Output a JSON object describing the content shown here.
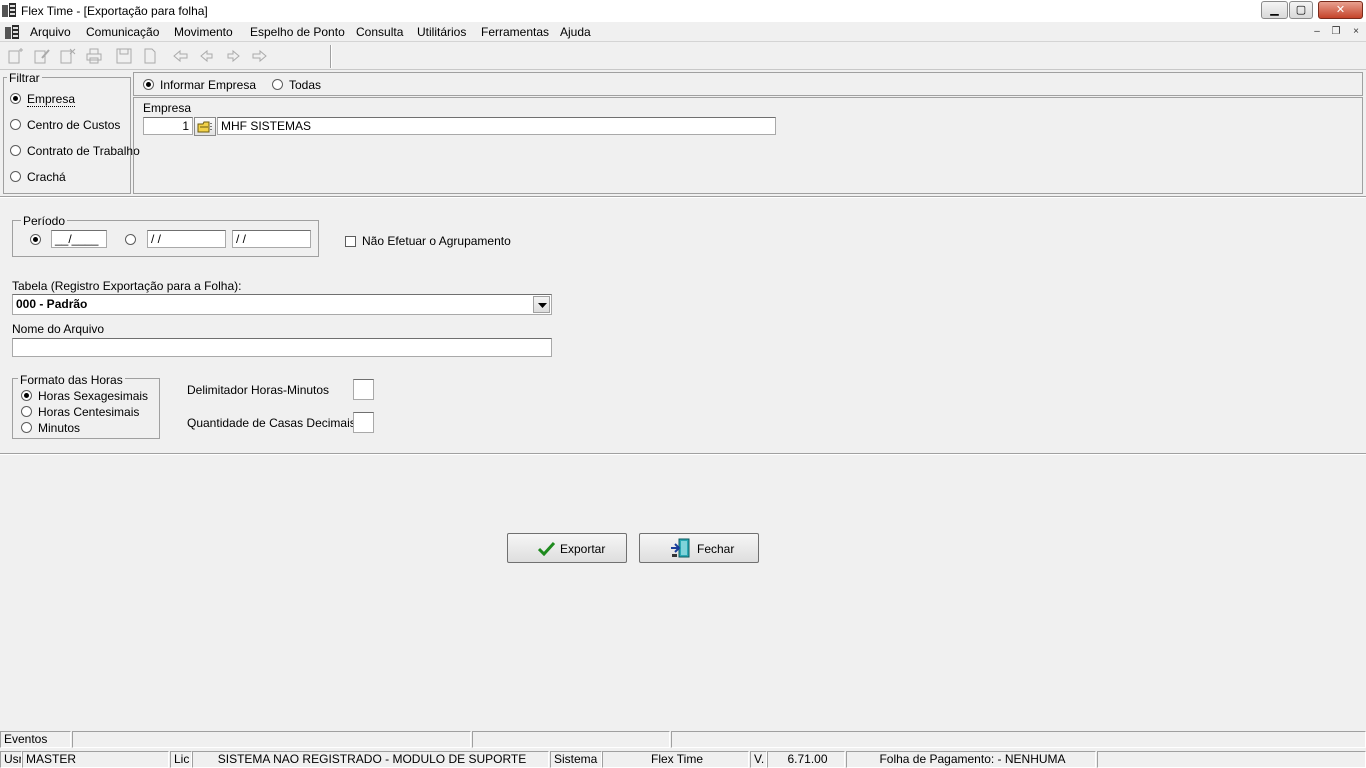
{
  "window": {
    "title": "Flex Time - [Exportação para folha]",
    "minimize": "▁",
    "maximize": "▢",
    "close": "✕"
  },
  "menu": [
    "Arquivo",
    "Comunicação",
    "Movimento",
    "Espelho de Ponto",
    "Consulta",
    "Utilitários",
    "Ferramentas",
    "Ajuda"
  ],
  "mdi": {
    "minimize": "–",
    "restore": "❐",
    "close": "×"
  },
  "filter": {
    "legend": "Filtrar",
    "options": [
      "Empresa",
      "Centro de Custos",
      "Contrato de Trabalho",
      "Crachá"
    ],
    "selected": "Empresa"
  },
  "scope": {
    "informar": "Informar Empresa",
    "todas": "Todas",
    "empresa_label": "Empresa",
    "empresa_code": "1",
    "empresa_name": "MHF SISTEMAS"
  },
  "periodo": {
    "legend": "Período",
    "month_value": "__/____",
    "date_start": " /  /",
    "date_end": " /  /",
    "no_group_label": "Não Efetuar o Agrupamento"
  },
  "tabela": {
    "label": "Tabela (Registro Exportação para a Folha):",
    "selected": "000 - Padrão"
  },
  "arquivo": {
    "label": "Nome do Arquivo",
    "value": ""
  },
  "formato": {
    "legend": "Formato das Horas",
    "options": [
      "Horas Sexagesimais",
      "Horas Centesimais",
      "Minutos"
    ],
    "selected": "Horas Sexagesimais",
    "delimitador_label": "Delimitador Horas-Minutos",
    "casas_label": "Quantidade de Casas Decimais"
  },
  "actions": {
    "exportar": "Exportar",
    "fechar": "Fechar"
  },
  "status": {
    "eventos": "Eventos",
    "usr_label": "Usr",
    "usr_value": "MASTER",
    "lic_label": "Lic",
    "lic_value": "SISTEMA NAO REGISTRADO - MODULO DE SUPORTE",
    "sistema_label": "Sistema",
    "sistema_value": "Flex Time",
    "version_label": "V.",
    "version_value": "6.71.00",
    "folha": "Folha de Pagamento:  - NENHUMA"
  },
  "colors": {
    "window_bg": "#f0f0f0",
    "export_check": "#1e8a1e",
    "close_btn": "#c5432a"
  }
}
